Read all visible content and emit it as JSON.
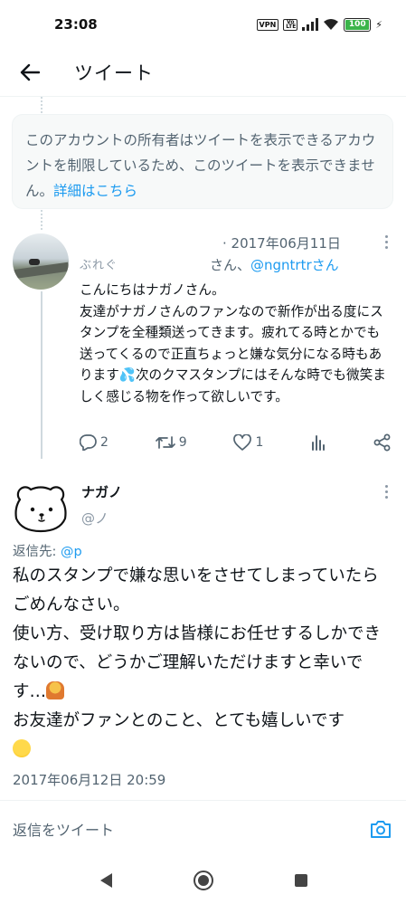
{
  "status_bar": {
    "time": "23:08",
    "vpn": "VPN",
    "lte": "Vo LTE",
    "battery": "100"
  },
  "header": {
    "title": "ツイート"
  },
  "notice": {
    "text": "このアカウントの所有者はツイートを表示できるアカウントを制限しているため、このツイートを表示できません。",
    "link": "詳細はこちら"
  },
  "reply_tweet": {
    "author_partial": "ぶれぐ",
    "date": "2017年06月11日",
    "reply_to_prefix": "さん、",
    "reply_to_mention": "@ngntrtr",
    "reply_to_suffix": "さん",
    "text": "こんにちはナガノさん。\n友達がナガノさんのファンなので新作が出る度にスタンプを全種類送ってきます。疲れてる時とかでも送ってくるので正直ちょっと嫌な気分になる時もあります💦次のクマスタンプにはそんな時でも微笑ましく感じる物を作って欲しいです。",
    "replies": "2",
    "retweets": "9",
    "likes": "1"
  },
  "main_tweet": {
    "name": "ナガノ",
    "handle": "@ノ",
    "reply_to_label": "返信先: ",
    "reply_to_mention": "@p",
    "text_lines": [
      "私のスタンプで嫌な思いをさせてしまっていたらごめんなさい。",
      "使い方、受け取り方は皆様にお任せするしかできないので、どうかご理解いただけますと幸いです…",
      "お友達がファンとのこと、とても嬉しいです"
    ],
    "date": "2017年06月12日 20:59"
  },
  "reply_bar": {
    "placeholder": "返信をツイート"
  },
  "colors": {
    "accent": "#1d9bf0",
    "secondary_text": "#536471",
    "notice_bg": "#f7f9f9"
  },
  "icons": [
    "back-arrow-icon",
    "more-icon",
    "reply-icon",
    "retweet-icon",
    "like-icon",
    "stats-icon",
    "share-icon",
    "camera-icon",
    "nav-back-icon",
    "nav-home-icon",
    "nav-recents-icon"
  ]
}
